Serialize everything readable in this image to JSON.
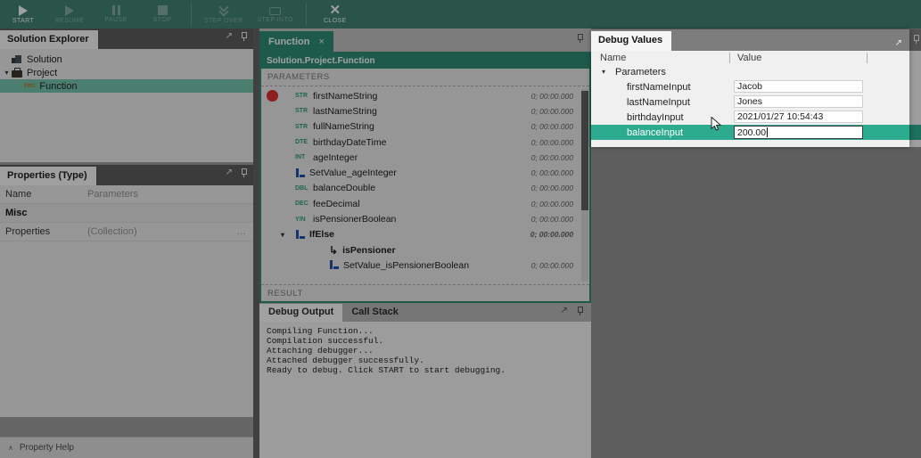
{
  "colors": {
    "accent_teal": "#2cab8e",
    "accent_teal_dark": "#2c8972",
    "toolbar_bg": "#41806f",
    "breakpoint_red": "#d62f2f",
    "setvalue_blue": "#2050a8",
    "type_badge_green": "#2f9a72"
  },
  "toolbar": {
    "buttons": [
      {
        "id": "start",
        "label": "START",
        "icon": "play-icon",
        "enabled": true,
        "group_start": false
      },
      {
        "id": "resume",
        "label": "RESUME",
        "icon": "play-icon",
        "enabled": false,
        "group_start": false
      },
      {
        "id": "pause",
        "label": "PAUSE",
        "icon": "pause-icon",
        "enabled": false,
        "group_start": false
      },
      {
        "id": "stop",
        "label": "STOP",
        "icon": "stop-icon",
        "enabled": false,
        "group_start": false
      },
      {
        "id": "step-over",
        "label": "STEP OVER",
        "icon": "step-over-icon",
        "enabled": false,
        "group_start": true
      },
      {
        "id": "step-into",
        "label": "STEP INTO",
        "icon": "step-into-icon",
        "enabled": false,
        "group_start": false
      },
      {
        "id": "close",
        "label": "CLOSE",
        "icon": "close-icon",
        "enabled": true,
        "group_start": true
      }
    ]
  },
  "solution_explorer": {
    "title": "Solution Explorer",
    "tree": [
      {
        "label": "Solution",
        "icon": "solution-icon",
        "level": 0,
        "expander": "",
        "selected": false,
        "badge": ""
      },
      {
        "label": "Project",
        "icon": "project-icon",
        "level": 0,
        "expander": "▾",
        "selected": false,
        "badge": ""
      },
      {
        "label": "Function",
        "icon": "",
        "level": 1,
        "expander": "",
        "selected": true,
        "badge": "FNC"
      }
    ]
  },
  "properties_panel": {
    "title": "Properties (Type)",
    "rows": [
      {
        "label": "Name",
        "value": "Parameters",
        "section": false,
        "ellipsis": ""
      },
      {
        "label": "Misc",
        "value": "",
        "section": true,
        "ellipsis": ""
      },
      {
        "label": "Properties",
        "value": "(Collection)",
        "section": false,
        "ellipsis": "…"
      }
    ],
    "help_label": "Property Help",
    "help_chevron": "∧"
  },
  "designer": {
    "tab_label": "Function",
    "tab_close": "×",
    "breadcrumb": "Solution.Project.Function",
    "parameters_label": "PARAMETERS",
    "result_label": "RESULT",
    "rows": [
      {
        "badge": "STR",
        "icon": "",
        "name": "firstNameString",
        "timer": "0; 00:00.000",
        "bold": false,
        "indent": 0,
        "expander": "",
        "breakpoint": true
      },
      {
        "badge": "STR",
        "icon": "",
        "name": "lastNameString",
        "timer": "0; 00:00.000",
        "bold": false,
        "indent": 0,
        "expander": "",
        "breakpoint": false
      },
      {
        "badge": "STR",
        "icon": "",
        "name": "fullNameString",
        "timer": "0; 00:00.000",
        "bold": false,
        "indent": 0,
        "expander": "",
        "breakpoint": false
      },
      {
        "badge": "DTE",
        "icon": "",
        "name": "birthdayDateTime",
        "timer": "0; 00:00.000",
        "bold": false,
        "indent": 0,
        "expander": "",
        "breakpoint": false
      },
      {
        "badge": "INT",
        "icon": "",
        "name": "ageInteger",
        "timer": "0; 00:00.000",
        "bold": false,
        "indent": 0,
        "expander": "",
        "breakpoint": false
      },
      {
        "badge": "",
        "icon": "setvalue-icon",
        "name": "SetValue_ageInteger",
        "timer": "0; 00:00.000",
        "bold": false,
        "indent": 0,
        "expander": "",
        "breakpoint": false
      },
      {
        "badge": "DBL",
        "icon": "",
        "name": "balanceDouble",
        "timer": "0; 00:00.000",
        "bold": false,
        "indent": 0,
        "expander": "",
        "breakpoint": false
      },
      {
        "badge": "DEC",
        "icon": "",
        "name": "feeDecimal",
        "timer": "0; 00:00.000",
        "bold": false,
        "indent": 0,
        "expander": "",
        "breakpoint": false
      },
      {
        "badge": "Y/N",
        "icon": "",
        "name": "isPensionerBoolean",
        "timer": "0; 00:00.000",
        "bold": false,
        "indent": 0,
        "expander": "",
        "breakpoint": false
      },
      {
        "badge": "",
        "icon": "setvalue-icon",
        "name": "IfElse",
        "timer": "0; 00:00.000",
        "bold": true,
        "indent": 0,
        "expander": "▾",
        "breakpoint": false
      },
      {
        "badge": "",
        "icon": "branch-arrow-icon",
        "name": "isPensioner",
        "timer": "",
        "bold": true,
        "indent": 1,
        "expander": "",
        "breakpoint": false
      },
      {
        "badge": "",
        "icon": "setvalue-icon",
        "name": "SetValue_isPensionerBoolean",
        "timer": "0; 00:00.000",
        "bold": false,
        "indent": 1,
        "expander": "",
        "breakpoint": false
      }
    ]
  },
  "debug_output": {
    "tabs": [
      {
        "label": "Debug Output",
        "active": true
      },
      {
        "label": "Call Stack",
        "active": false
      }
    ],
    "lines": [
      "Compiling Function...",
      "Compilation successful.",
      "Attaching debugger...",
      "Attached debugger successfully.",
      "Ready to debug. Click START to start debugging."
    ]
  },
  "debug_values": {
    "title": "Debug Values",
    "columns": [
      "Name",
      "Value"
    ],
    "rows": [
      {
        "name": "Parameters",
        "value": "",
        "group": true,
        "selected": false,
        "editing": false
      },
      {
        "name": "firstNameInput",
        "value": "Jacob",
        "group": false,
        "selected": false,
        "editing": false
      },
      {
        "name": "lastNameInput",
        "value": "Jones",
        "group": false,
        "selected": false,
        "editing": false
      },
      {
        "name": "birthdayInput",
        "value": "2021/01/27 10:54:43",
        "group": false,
        "selected": false,
        "editing": false
      },
      {
        "name": "balanceInput",
        "value": "200.00",
        "group": false,
        "selected": true,
        "editing": true
      }
    ]
  }
}
